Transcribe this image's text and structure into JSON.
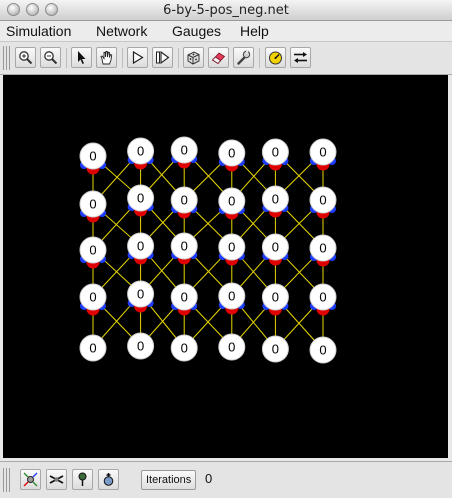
{
  "window": {
    "title": "6-by-5-pos_neg.net"
  },
  "menu": [
    "Simulation",
    "Network",
    "Gauges",
    "Help"
  ],
  "toolbar": [
    {
      "icon": "zoom-in-icon"
    },
    {
      "icon": "zoom-out-icon"
    },
    {
      "icon": "select-pointer-icon"
    },
    {
      "icon": "pan-hand-icon"
    },
    {
      "icon": "play-icon"
    },
    {
      "icon": "step-icon"
    },
    {
      "icon": "randomize-icon"
    },
    {
      "icon": "clear-eraser-icon"
    },
    {
      "icon": "preferences-wrench-icon"
    },
    {
      "icon": "gauge-icon"
    },
    {
      "icon": "swap-arrows-icon"
    }
  ],
  "network": {
    "rows": 5,
    "cols": 6,
    "neuron_activation": "0",
    "colors": {
      "background": "#000000",
      "neuron": "#ffffff",
      "synapse": "#e8d800",
      "excitatory": "#e00000",
      "inhibitory": "#1e3cff"
    },
    "neurons": [
      [
        "0",
        "0",
        "0",
        "0",
        "0",
        "0"
      ],
      [
        "0",
        "0",
        "0",
        "0",
        "0",
        "0"
      ],
      [
        "0",
        "0",
        "0",
        "0",
        "0",
        "0"
      ],
      [
        "0",
        "0",
        "0",
        "0",
        "0",
        "0"
      ],
      [
        "0",
        "0",
        "0",
        "0",
        "0",
        "0"
      ]
    ]
  },
  "statusbar": {
    "buttons": [
      {
        "icon": "neuron-gauge-icon"
      },
      {
        "icon": "network-gauge-icon"
      },
      {
        "icon": "probe-icon"
      },
      {
        "icon": "add-gauge-icon"
      }
    ],
    "iterations_label": "Iterations",
    "iterations_value": "0"
  }
}
